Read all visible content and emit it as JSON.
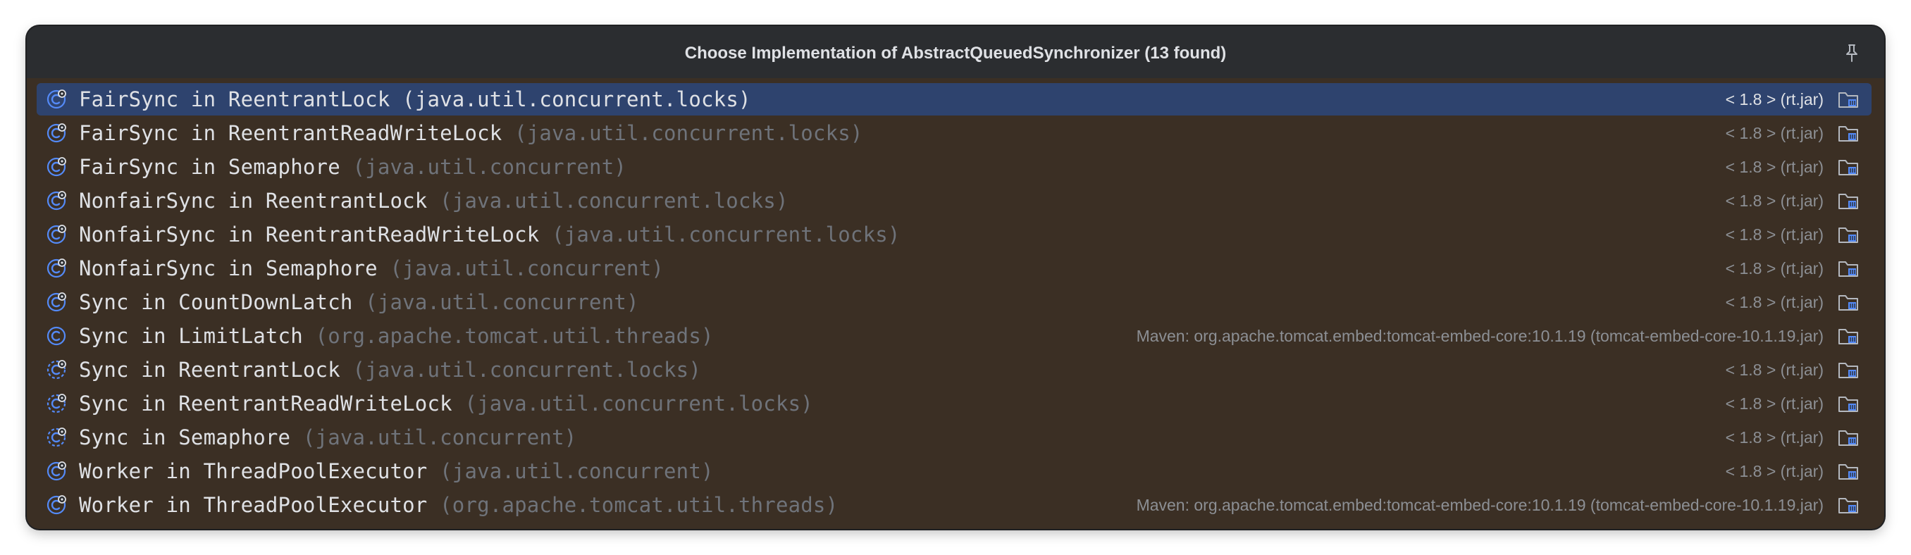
{
  "popup": {
    "title": "Choose Implementation of AbstractQueuedSynchronizer (13 found)",
    "pin_icon": "pin-icon"
  },
  "rows": [
    {
      "name": "FairSync in ReentrantLock",
      "pkg": "(java.util.concurrent.locks)",
      "lib": "< 1.8 > (rt.jar)",
      "icon": "inner-class-icon",
      "selected": true
    },
    {
      "name": "FairSync in ReentrantReadWriteLock",
      "pkg": "(java.util.concurrent.locks)",
      "lib": "< 1.8 > (rt.jar)",
      "icon": "inner-class-icon",
      "selected": false
    },
    {
      "name": "FairSync in Semaphore",
      "pkg": "(java.util.concurrent)",
      "lib": "< 1.8 > (rt.jar)",
      "icon": "inner-class-icon",
      "selected": false
    },
    {
      "name": "NonfairSync in ReentrantLock",
      "pkg": "(java.util.concurrent.locks)",
      "lib": "< 1.8 > (rt.jar)",
      "icon": "inner-class-icon",
      "selected": false
    },
    {
      "name": "NonfairSync in ReentrantReadWriteLock",
      "pkg": "(java.util.concurrent.locks)",
      "lib": "< 1.8 > (rt.jar)",
      "icon": "inner-class-icon",
      "selected": false
    },
    {
      "name": "NonfairSync in Semaphore",
      "pkg": "(java.util.concurrent)",
      "lib": "< 1.8 > (rt.jar)",
      "icon": "inner-class-icon",
      "selected": false
    },
    {
      "name": "Sync in CountDownLatch",
      "pkg": "(java.util.concurrent)",
      "lib": "< 1.8 > (rt.jar)",
      "icon": "inner-class-icon",
      "selected": false
    },
    {
      "name": "Sync in LimitLatch",
      "pkg": "(org.apache.tomcat.util.threads)",
      "lib": "Maven: org.apache.tomcat.embed:tomcat-embed-core:10.1.19 (tomcat-embed-core-10.1.19.jar)",
      "icon": "class-icon",
      "selected": false
    },
    {
      "name": "Sync in ReentrantLock",
      "pkg": "(java.util.concurrent.locks)",
      "lib": "< 1.8 > (rt.jar)",
      "icon": "abstract-class-icon",
      "selected": false
    },
    {
      "name": "Sync in ReentrantReadWriteLock",
      "pkg": "(java.util.concurrent.locks)",
      "lib": "< 1.8 > (rt.jar)",
      "icon": "abstract-class-icon",
      "selected": false
    },
    {
      "name": "Sync in Semaphore",
      "pkg": "(java.util.concurrent)",
      "lib": "< 1.8 > (rt.jar)",
      "icon": "abstract-class-icon",
      "selected": false
    },
    {
      "name": "Worker in ThreadPoolExecutor",
      "pkg": "(java.util.concurrent)",
      "lib": "< 1.8 > (rt.jar)",
      "icon": "inner-class-icon",
      "selected": false
    },
    {
      "name": "Worker in ThreadPoolExecutor",
      "pkg": "(org.apache.tomcat.util.threads)",
      "lib": "Maven: org.apache.tomcat.embed:tomcat-embed-core:10.1.19 (tomcat-embed-core-10.1.19.jar)",
      "icon": "inner-class-icon",
      "selected": false
    }
  ],
  "library_icon": "library-folder-icon",
  "colors": {
    "popup_bg": "#2b2d30",
    "list_bg": "#3b2f24",
    "selection": "#2e436e",
    "text": "#dfe1e5",
    "muted": "#6f737a",
    "icon_blue": "#548af7"
  }
}
